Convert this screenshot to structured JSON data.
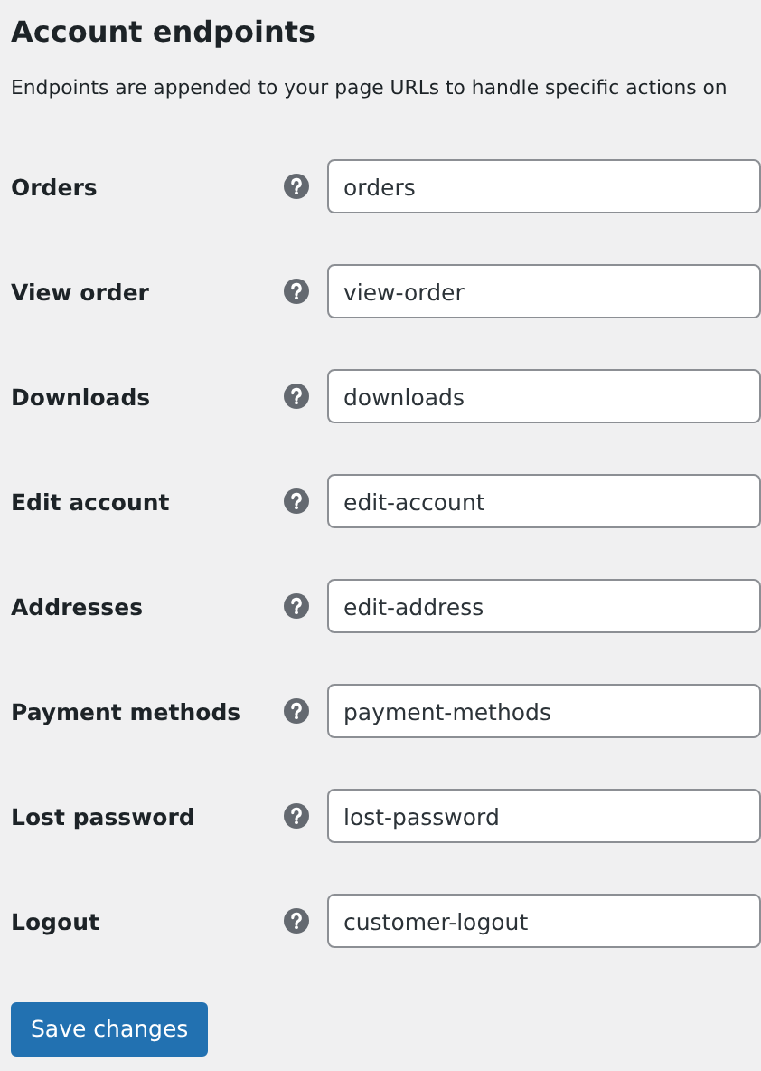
{
  "heading": "Account endpoints",
  "description": "Endpoints are appended to your page URLs to handle specific actions on",
  "fields": [
    {
      "label": "Orders",
      "value": "orders"
    },
    {
      "label": "View order",
      "value": "view-order"
    },
    {
      "label": "Downloads",
      "value": "downloads"
    },
    {
      "label": "Edit account",
      "value": "edit-account"
    },
    {
      "label": "Addresses",
      "value": "edit-address"
    },
    {
      "label": "Payment methods",
      "value": "payment-methods"
    },
    {
      "label": "Lost password",
      "value": "lost-password"
    },
    {
      "label": "Logout",
      "value": "customer-logout"
    }
  ],
  "save_button": "Save changes"
}
